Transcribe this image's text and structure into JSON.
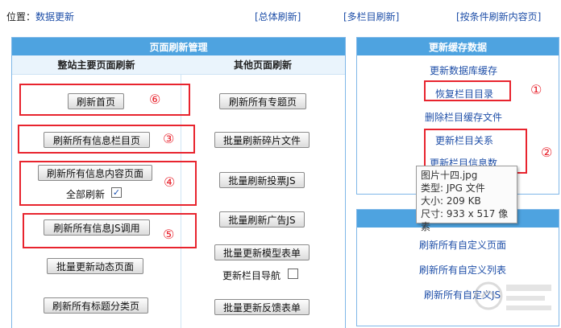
{
  "topbar": {
    "location_label": "位置：",
    "location_value": "数据更新",
    "link_total": "[总体刷新]",
    "link_multi": "[多栏目刷新]",
    "link_condition": "[按条件刷新内容页]"
  },
  "left_panel": {
    "title": "页面刷新管理",
    "col1_title": "整站主要页面刷新",
    "col2_title": "其他页面刷新",
    "col1": {
      "refresh_home": "刷新首页",
      "refresh_class_pages": "刷新所有信息栏目页",
      "refresh_content_pages": "刷新所有信息内容页面",
      "refresh_all_label": "全部刷新",
      "refresh_js": "刷新所有信息JS调用",
      "update_dynamic": "批量更新动态页面",
      "refresh_title_class": "刷新所有标题分类页"
    },
    "col2": {
      "refresh_topics": "刷新所有专题页",
      "refresh_fragments": "批量刷新碎片文件",
      "refresh_vote_js": "批量刷新投票JS",
      "refresh_ad_js": "批量刷新广告JS",
      "update_model_form": "批量更新模型表单",
      "update_class_nav": "更新栏目导航",
      "update_feedback_form": "批量更新反馈表单"
    }
  },
  "right_panel": {
    "title": "更新缓存数据",
    "links": {
      "update_db_cache": "更新数据库缓存",
      "restore_class_dir": "恢复栏目目录",
      "delete_class_cache": "删除栏目缓存文件",
      "update_class_relation": "更新栏目关系",
      "update_class_info_count": "更新栏目信息数"
    }
  },
  "right_panel2": {
    "title": "",
    "links": {
      "refresh_custom_pages": "刷新所有自定义页面",
      "refresh_custom_lists": "刷新所有自定义列表",
      "refresh_custom_js": "刷新所有自定义JS"
    }
  },
  "annotations": {
    "n1": "①",
    "n2": "②",
    "n3": "③",
    "n4": "④",
    "n5": "⑤",
    "n6": "⑥"
  },
  "tooltip": {
    "name": "图片十四.jpg",
    "type": "类型: JPG 文件",
    "size": "大小: 209 KB",
    "dims": "尺寸: 933 x 517 像素"
  },
  "checkbox": {
    "refresh_all_checked": "✓"
  },
  "colors": {
    "header_blue": "#4ea3e0",
    "border_blue": "#7fb7e8",
    "link_blue": "#1f4fa8",
    "annotation_red": "#e8242e"
  }
}
